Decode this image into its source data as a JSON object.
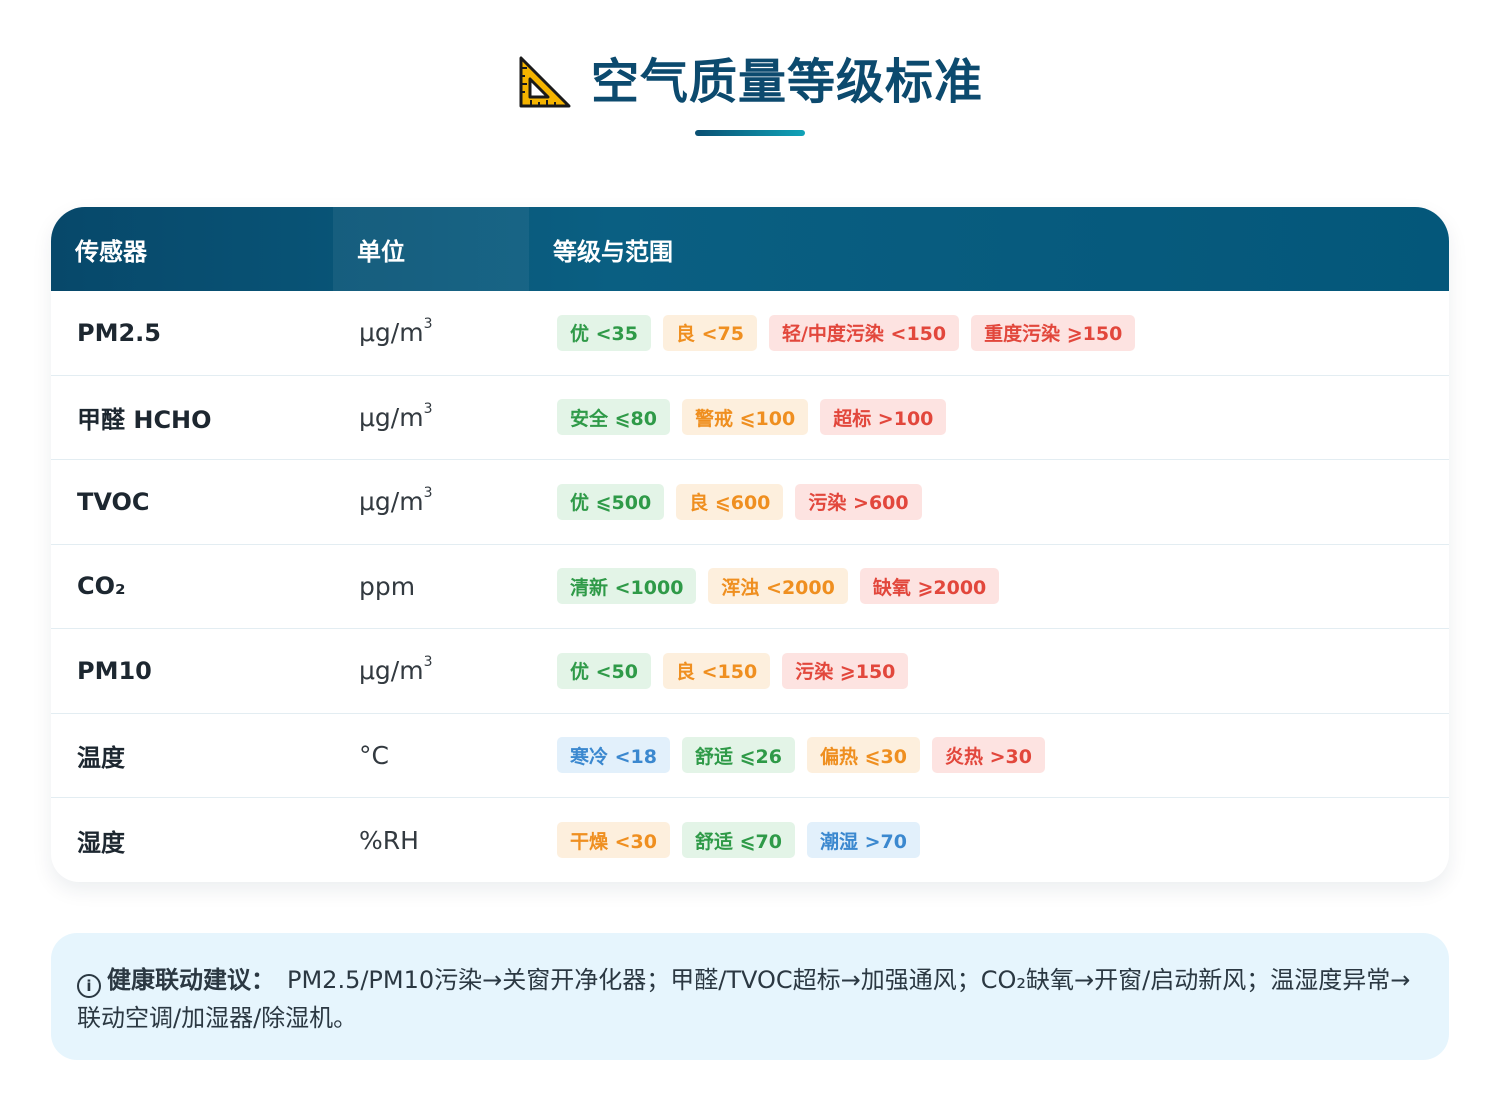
{
  "header": {
    "title": "空气质量等级标准",
    "icon": "triangle-ruler-icon"
  },
  "table": {
    "columns": [
      "传感器",
      "单位",
      "等级与范围"
    ],
    "rows": [
      {
        "sensor": "PM2.5",
        "unit_base": "μg/m",
        "unit_sup": "3",
        "levels": [
          {
            "label": "优 <35",
            "color": "green"
          },
          {
            "label": "良 <75",
            "color": "orange"
          },
          {
            "label": "轻/中度污染 <150",
            "color": "red"
          },
          {
            "label": "重度污染 ⩾150",
            "color": "red"
          }
        ]
      },
      {
        "sensor": "甲醛 HCHO",
        "unit_base": "μg/m",
        "unit_sup": "3",
        "levels": [
          {
            "label": "安全 ⩽80",
            "color": "green"
          },
          {
            "label": "警戒 ⩽100",
            "color": "orange"
          },
          {
            "label": "超标 >100",
            "color": "red"
          }
        ]
      },
      {
        "sensor": "TVOC",
        "unit_base": "μg/m",
        "unit_sup": "3",
        "levels": [
          {
            "label": "优 ⩽500",
            "color": "green"
          },
          {
            "label": "良 ⩽600",
            "color": "orange"
          },
          {
            "label": "污染 >600",
            "color": "red"
          }
        ]
      },
      {
        "sensor": "CO₂",
        "unit_base": "ppm",
        "unit_sup": "",
        "levels": [
          {
            "label": "清新 <1000",
            "color": "green"
          },
          {
            "label": "浑浊 <2000",
            "color": "orange"
          },
          {
            "label": "缺氧 ⩾2000",
            "color": "red"
          }
        ]
      },
      {
        "sensor": "PM10",
        "unit_base": "μg/m",
        "unit_sup": "3",
        "levels": [
          {
            "label": "优 <50",
            "color": "green"
          },
          {
            "label": "良 <150",
            "color": "orange"
          },
          {
            "label": "污染 ⩾150",
            "color": "red"
          }
        ]
      },
      {
        "sensor": "温度",
        "unit_base": "°C",
        "unit_sup": "",
        "levels": [
          {
            "label": "寒冷 <18",
            "color": "blue"
          },
          {
            "label": "舒适 ⩽26",
            "color": "green"
          },
          {
            "label": "偏热 ⩽30",
            "color": "orange"
          },
          {
            "label": "炎热 >30",
            "color": "red"
          }
        ]
      },
      {
        "sensor": "湿度",
        "unit_base": "%RH",
        "unit_sup": "",
        "levels": [
          {
            "label": "干燥 <30",
            "color": "orange"
          },
          {
            "label": "舒适 ⩽70",
            "color": "green"
          },
          {
            "label": "潮湿 >70",
            "color": "blue"
          }
        ]
      }
    ]
  },
  "advice": {
    "icon": "info-circle-icon",
    "label": "健康联动建议：",
    "text": "PM2.5/PM10污染→关窗开净化器；甲醛/TVOC超标→加强通风；CO₂缺氧→开窗/启动新风；温湿度异常→联动空调/加湿器/除湿机。"
  },
  "colors": {
    "title": "#0c4a6e",
    "header_bg": "#07486a",
    "green": "#2f9a48",
    "orange": "#ef8f20",
    "red": "#e2473c",
    "blue": "#3b88cf",
    "advice_bg": "#e6f5fd"
  }
}
